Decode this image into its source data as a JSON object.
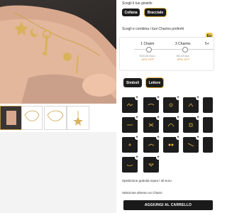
{
  "jewel": {
    "label": "Scegli il tuo gioiello",
    "options": [
      "Collana",
      "Bracciale"
    ],
    "selected": "Bracciale"
  },
  "charms_section": {
    "label": "Scegli e combina i tuoi Charms preferiti",
    "badge_text": "Eu",
    "options": [
      {
        "label": "1 Charm",
        "price": "€15.00 Euro",
        "discount": "-50% OFF"
      },
      {
        "label": "3 Charms",
        "price": "€6.4 Euro",
        "discount": "-50% OFF"
      },
      {
        "label": "5+",
        "price": "",
        "discount": ""
      }
    ]
  },
  "filter_tabs": [
    "Simboli",
    "Lettere"
  ],
  "active_filter": "Lettere",
  "shipping_note": "Spedizione gratuita sopra i 30 euro",
  "selection_hint": "Selezione almeno un Charm",
  "cta_label": "AGGIUNGI AL CARRELLO",
  "colors": {
    "accent_gold": "#e3b341",
    "dark": "#1d1d1d"
  }
}
